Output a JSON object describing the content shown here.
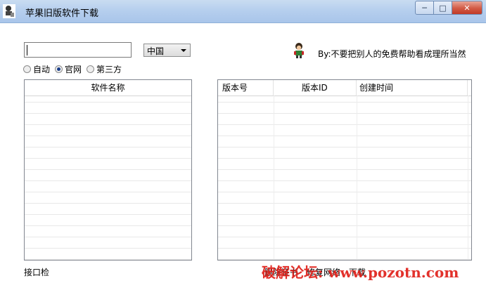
{
  "window": {
    "title": "苹果旧版软件下载",
    "min_glyph": "─",
    "max_glyph": "□",
    "close_glyph": "✕"
  },
  "search": {
    "value": "",
    "country": "中国"
  },
  "source_options": [
    {
      "label": "自动",
      "checked": false
    },
    {
      "label": "官网",
      "checked": true
    },
    {
      "label": "第三方",
      "checked": false
    }
  ],
  "byline": "By:不要把别人的免费帮助看成理所当然",
  "left_list": {
    "header": "软件名称"
  },
  "right_list": {
    "columns": [
      "版本号",
      "版本ID",
      "创建时间"
    ]
  },
  "footer": {
    "status": "接口检",
    "actions": [
      "删除证书",
      "修复网络",
      "下载"
    ],
    "watermark": "破解论坛: www.pozotn.com"
  },
  "colors": {
    "titlebar": "#b6cfee",
    "close_button": "#d25a45",
    "watermark": "#e0201a"
  }
}
